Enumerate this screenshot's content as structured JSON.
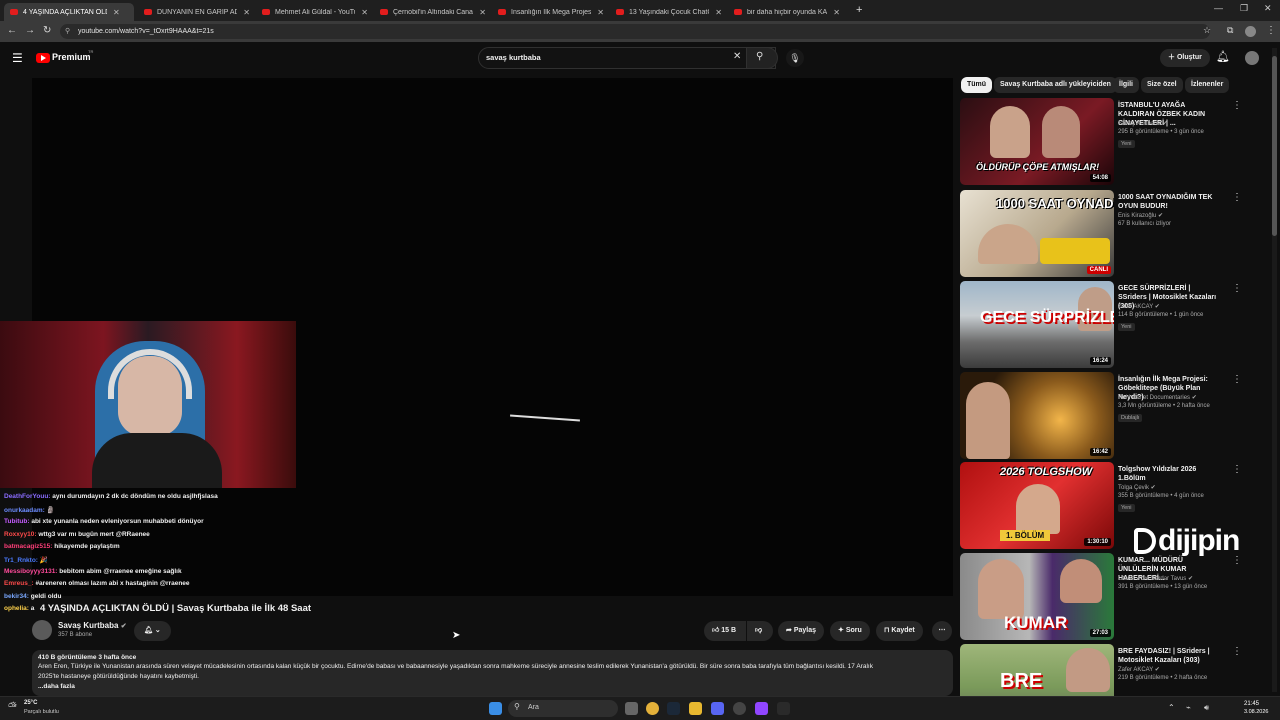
{
  "browser": {
    "tabs": [
      {
        "title": "4 YAŞINDA AÇLIKTAN ÖLDÜ | S",
        "active": true
      },
      {
        "title": "DÜNYANIN EN GARİP ADASINI",
        "active": false
      },
      {
        "title": "Mehmet Ali Güldal - YouTube",
        "active": false
      },
      {
        "title": "Çernobil'in Altındaki Canavar U",
        "active": false
      },
      {
        "title": "İnsanlığın İlk Mega Projesi Göb",
        "active": false
      },
      {
        "title": "13 Yaşındaki Çocuk ChatGPT ile",
        "active": false
      },
      {
        "title": "bir daha hiçbir oyunda KAZANA",
        "active": false
      }
    ],
    "new_tab": "+",
    "url": "youtube.com/watch?v=_tOxrt9HAAA&t=21s"
  },
  "youtube": {
    "logo": "Premium",
    "logo_sup": "TR",
    "search_value": "savaş kurtbaba",
    "create_label": "Oluştur"
  },
  "chat": [
    {
      "user": "DeathForYouu:",
      "msg": "aynı durumdayın 2 dk dc döndüm ne oldu asjlhfjslasa",
      "color": "#8a6cff"
    },
    {
      "user": "onurkaadam:",
      "msg": "🗿",
      "color": "#6c8cff"
    },
    {
      "user": "Tubitub:",
      "msg": "abi xte yunanla neden evleniyorsun muhabbeti dönüyor",
      "color": "#c45cff"
    },
    {
      "user": "Roxxyy10:",
      "msg": "wttg3 var mı bugün mert @RRaenee",
      "color": "#ff4b4b"
    },
    {
      "user": "batmacagiz515:",
      "msg": "hikayemde paylaştım",
      "color": "#ff3f7a"
    },
    {
      "user": "Tr1_Rnkto:",
      "msg": "🎉",
      "color": "#4b7bff"
    },
    {
      "user": "Messiboyyy3131:",
      "msg": "bebitom abim @rraenee emeğine sağlık",
      "color": "#ff4b9b"
    },
    {
      "user": "Emreus_:",
      "msg": "#areneren olması lazım abi x hastaginin @rraenee",
      "color": "#ff4b4b"
    },
    {
      "user": "bekir34:",
      "msg": "geldi oldu",
      "color": "#7aa8ff"
    },
    {
      "user": "ophelia:",
      "msg": "a",
      "color": "#ffd24b"
    }
  ],
  "video": {
    "title": "4 YAŞINDA AÇLIKTAN ÖLDÜ | Savaş Kurtbaba ile İlk 48 Saat",
    "channel": "Savaş Kurtbaba",
    "subscribers": "357 B abone",
    "likes": "15 B",
    "share_label": "Paylaş",
    "ask_label": "Soru",
    "save_label": "Kaydet",
    "views_date": "410 B görüntüleme  3 hafta önce",
    "description_line1": "Aren Eren, Türkiye ile Yunanistan arasında süren velayet mücadelesinin ortasında kalan küçük bir çocuktu. Edirne'de babası ve babaannesiyle yaşadıktan sonra mahkeme süreciyle annesine teslim edilerek Yunanistan'a götürüldü. Bir süre sonra baba tarafıyla tüm bağlantısı kesildi. 17 Aralık",
    "description_line2": "2025'te hastaneye götürüldüğünde hayatını kaybetmişti.",
    "more_label": "...daha fazla"
  },
  "chips": [
    {
      "label": "Tümü",
      "selected": true
    },
    {
      "label": "Savaş Kurtbaba adlı yükleyiciden",
      "selected": false
    },
    {
      "label": "İlgili",
      "selected": false
    },
    {
      "label": "Size özel",
      "selected": false
    },
    {
      "label": "İzlenenler",
      "selected": false
    }
  ],
  "recommendations": [
    {
      "title": "İSTANBUL'U AYAĞA KALDIRAN ÖZBEK KADIN CİNAYETLERİ | ...",
      "channel": "Savaş Kurtbaba ✔",
      "meta": "295 B görüntüleme • 3 gün önce",
      "badge": "Yeni",
      "duration": "54:08",
      "thumb_text": "ÖLDÜRÜP ÇÖPE ATMIŞLAR!"
    },
    {
      "title": "1000 SAAT OYNADIĞIM TEK OYUN BUDUR!",
      "channel": "Enis Kirazoğlu ✔",
      "meta": "67 B kullanıcı izliyor",
      "badge": "",
      "duration": "CANLI",
      "thumb_text": "1000 SAAT OYNADIĞIM OYUN"
    },
    {
      "title": "GECE SÜRPRİZLERİ | SSriders | Motosiklet Kazaları (305)",
      "channel": "Zafer AKCAY ✔",
      "meta": "114 B görüntüleme • 1 gün önce",
      "badge": "Yeni",
      "duration": "16:24",
      "thumb_text": "GECE SÜRPRİZLERİ"
    },
    {
      "title": "İnsanlığın İlk Mega Projesi: Göbeklitepe (Büyük Plan Neydi?)",
      "channel": "Ruhi Cenet Documentaries ✔",
      "meta": "3,3 Mn görüntüleme • 2 hafta önce",
      "badge": "Dublajlı",
      "duration": "16:42",
      "thumb_text": ""
    },
    {
      "title": "Tolgshow Yıldızlar 2026 1.Bölüm",
      "channel": "Tolga Çevik ✔",
      "meta": "355 B görüntüleme • 4 gün önce",
      "badge": "Yeni",
      "duration": "1:30:10",
      "thumb_text": "2026 TOLGSHOW"
    },
    {
      "title": "KUMAR... MÜDÜRÜ ÜNLÜLERİN KUMAR HABERLERİ...",
      "channel": "Literat ✔ ve Serdar Tavus ✔",
      "meta": "391 B görüntüleme • 13 gün önce",
      "badge": "",
      "duration": "27:03",
      "thumb_text": "KUMAR"
    },
    {
      "title": "BRE FAYDASIZ! | SSriders | Motosiklet Kazaları (303)",
      "channel": "Zafer AKCAY ✔",
      "meta": "219 B görüntüleme • 2 hafta önce",
      "badge": "",
      "duration": "",
      "thumb_text": "BRE"
    }
  ],
  "overlay_logo": "dijipin",
  "taskbar": {
    "weather_temp": "25°C",
    "weather_desc": "Parçalı bulutlu",
    "search_placeholder": "Ara",
    "time": "21:45",
    "date": "3.08.2026"
  },
  "colors": {
    "youtube_red": "#ff0000",
    "background": "#0f0f0f",
    "chip": "#272727"
  }
}
